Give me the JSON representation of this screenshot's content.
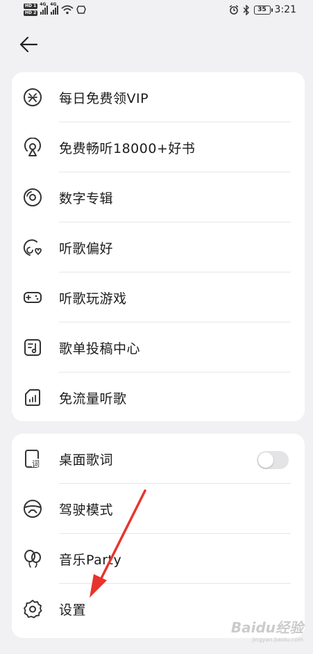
{
  "status_bar": {
    "sim1": "HD 1",
    "sim2": "HD 2",
    "net1": "4G",
    "net2": "4G",
    "battery": "35",
    "time": "3:21",
    "icons": [
      "alarm-icon",
      "bluetooth-icon",
      "battery-icon"
    ]
  },
  "header": {
    "back_icon": "arrow-left-icon"
  },
  "menu_group_1": [
    {
      "label": "每日免费领VIP",
      "icon": "award-badge-icon"
    },
    {
      "label": "免费畅听18000+好书",
      "icon": "podcast-icon"
    },
    {
      "label": "数字专辑",
      "icon": "disc-icon"
    },
    {
      "label": "听歌偏好",
      "icon": "music-heart-icon"
    },
    {
      "label": "听歌玩游戏",
      "icon": "gamepad-icon"
    },
    {
      "label": "歌单投稿中心",
      "icon": "playlist-icon"
    },
    {
      "label": "免流量听歌",
      "icon": "sim-card-icon"
    }
  ],
  "menu_group_2": [
    {
      "label": "桌面歌词",
      "icon": "lyrics-icon",
      "toggle": false
    },
    {
      "label": "驾驶模式",
      "icon": "steering-wheel-icon"
    },
    {
      "label": "音乐Party",
      "icon": "balloon-icon"
    },
    {
      "label": "设置",
      "icon": "gear-icon"
    }
  ],
  "annotation": {
    "color": "#e8342c"
  },
  "watermark": {
    "text": "Baidu经验",
    "sub": "jingyan.baidu.com"
  }
}
